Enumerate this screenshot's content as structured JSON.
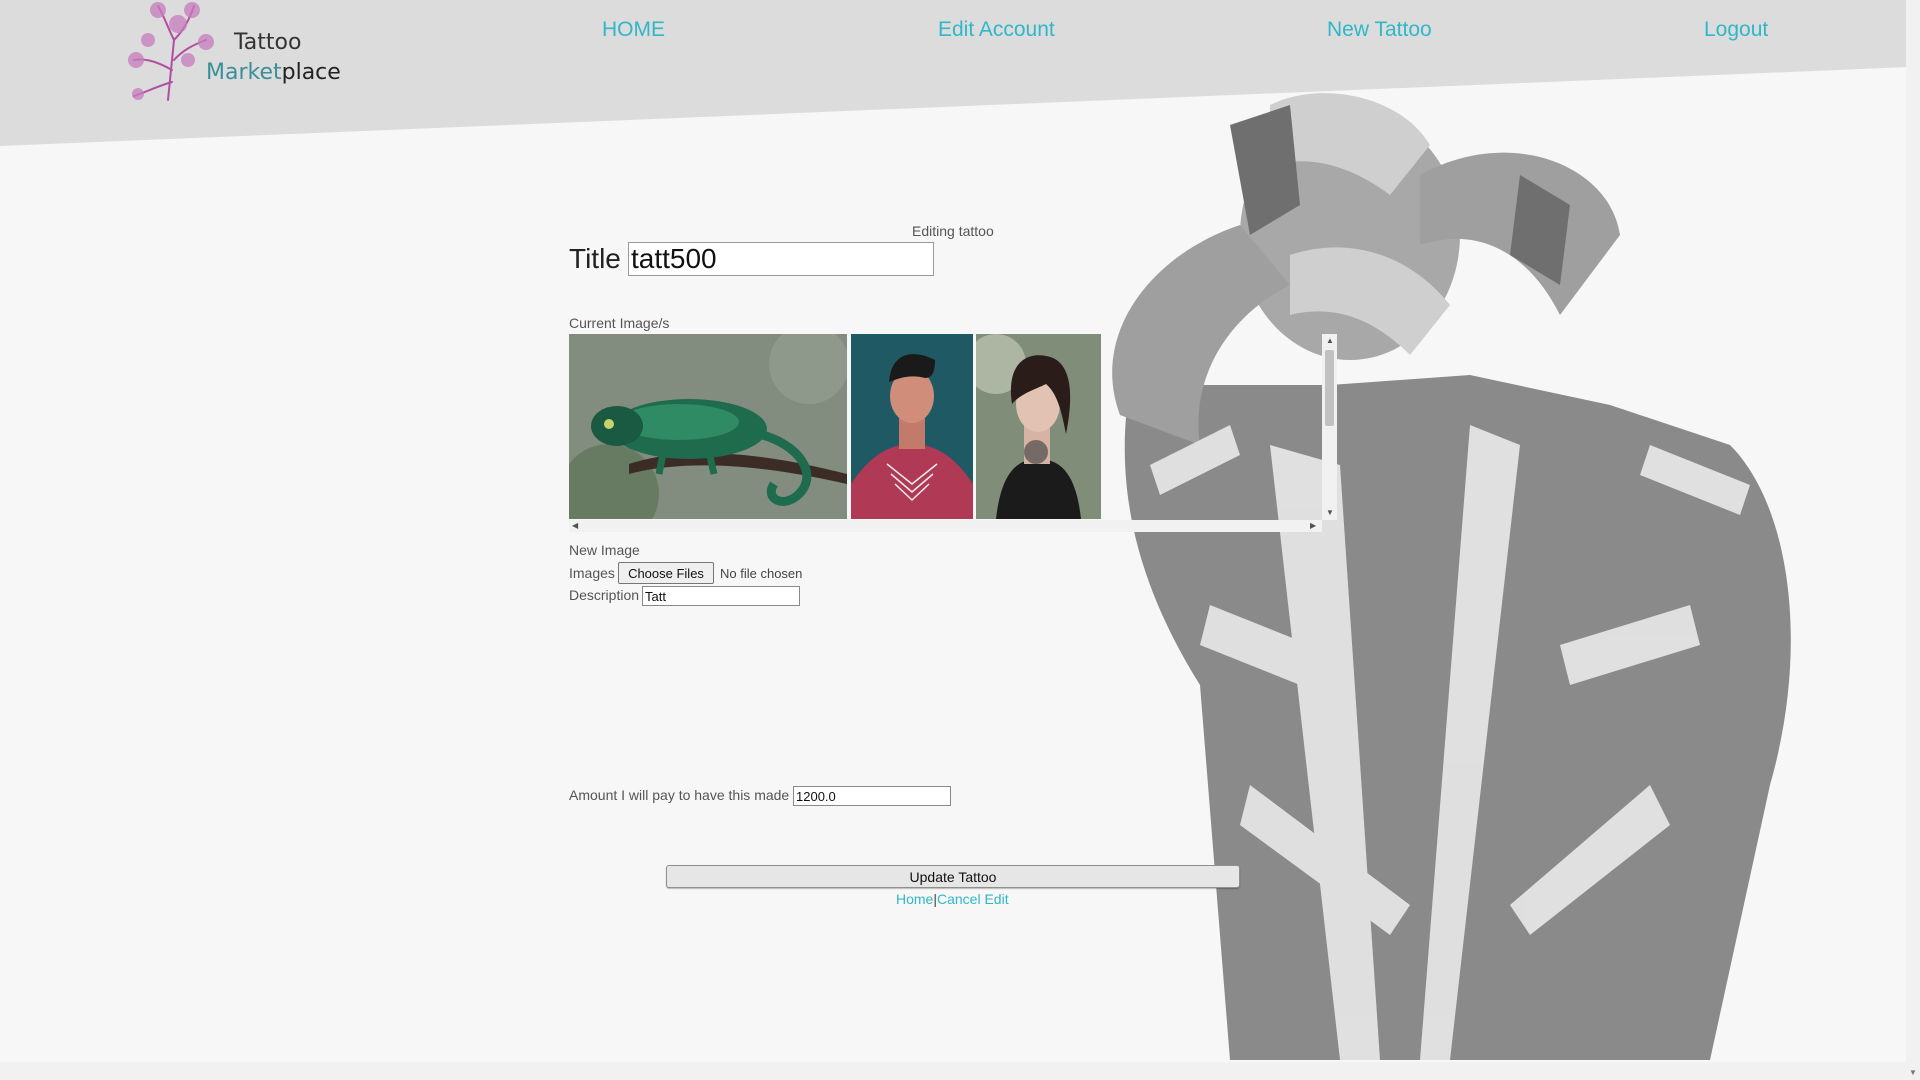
{
  "brand": {
    "line1": "Tattoo",
    "line2_a": "Market",
    "line2_b": "place"
  },
  "nav": {
    "home": "HOME",
    "edit_account": "Edit Account",
    "new_tattoo": "New Tattoo",
    "logout": "Logout"
  },
  "form": {
    "heading": "Editing tattoo",
    "title_label": "Title",
    "title_value": "tatt500",
    "current_images_label": "Current Image/s",
    "new_image_label": "New Image",
    "images_label": "Images",
    "choose_files": "Choose Files",
    "no_file": "No file chosen",
    "description_label": "Description",
    "description_value": "Tatt",
    "amount_label": "Amount I will pay to have this made",
    "amount_value": "1200.0",
    "submit": "Update Tattoo",
    "link_home": "Home",
    "separator": "|",
    "link_cancel": "Cancel Edit"
  },
  "colors": {
    "accent": "#2eb8c8",
    "header_bg": "#dcdcdc",
    "page_bg": "#f7f7f7"
  }
}
